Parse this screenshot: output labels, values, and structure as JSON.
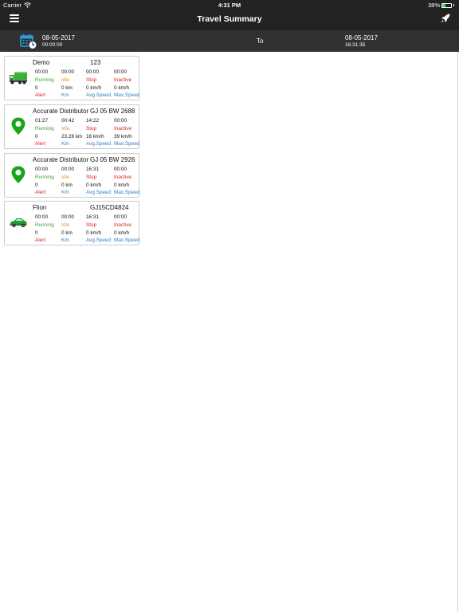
{
  "status_bar": {
    "carrier": "Carrier",
    "time": "4:31 PM",
    "battery_text": "38%",
    "battery_level": 0.38
  },
  "nav": {
    "title": "Travel Summary",
    "menu_icon": "hamburger-menu-icon",
    "action_icon": "rocket-icon"
  },
  "date_range": {
    "from_date": "08-05-2017",
    "from_time": "00:00:00",
    "to_label": "To",
    "to_date": "08-05-2017",
    "to_time": "16:31:35",
    "calendar_icon": "calendar-clock-icon"
  },
  "colors": {
    "running": "#3fa535",
    "idle": "#f19a1f",
    "stop_inactive_alert": "#e2221b",
    "km_speed": "#2f7ec7"
  },
  "labels": {
    "running": "Running",
    "idle": "Idle",
    "stop": "Stop",
    "inactive": "Inactive",
    "alert": "Alert",
    "km": "Km",
    "avg_speed": "Avg.Speed",
    "max_speed": "Max.Speed"
  },
  "vehicles": [
    {
      "name": "Demo",
      "plate": "123",
      "icon": "green-truck-icon",
      "running": "00:00",
      "idle": "00:00",
      "stop": "00:00",
      "inactive": "00:00",
      "alert": "0",
      "km": "0 km",
      "avg_speed": "0 km/h",
      "max_speed": "0 km/h"
    },
    {
      "name": "Accurate Distributor",
      "plate": "GJ 05 BW 2688",
      "icon": "map-pin-icon",
      "running": "01:27",
      "idle": "00:42",
      "stop": "14:22",
      "inactive": "00:00",
      "alert": "0",
      "km": "23.28 km",
      "avg_speed": "16 km/h",
      "max_speed": "39 km/h"
    },
    {
      "name": "Accurate Distributor",
      "plate": "GJ 05 BW 2926",
      "icon": "map-pin-icon",
      "running": "00:00",
      "idle": "00:00",
      "stop": "16:31",
      "inactive": "00:00",
      "alert": "0",
      "km": "0 km",
      "avg_speed": "0 km/h",
      "max_speed": "0 km/h"
    },
    {
      "name": "Flion",
      "plate": "GJ15CD4824",
      "icon": "green-car-icon",
      "running": "00:00",
      "idle": "00:00",
      "stop": "16:31",
      "inactive": "00:00",
      "alert": "0",
      "km": "0 km",
      "avg_speed": "0 km/h",
      "max_speed": "0 km/h"
    }
  ]
}
